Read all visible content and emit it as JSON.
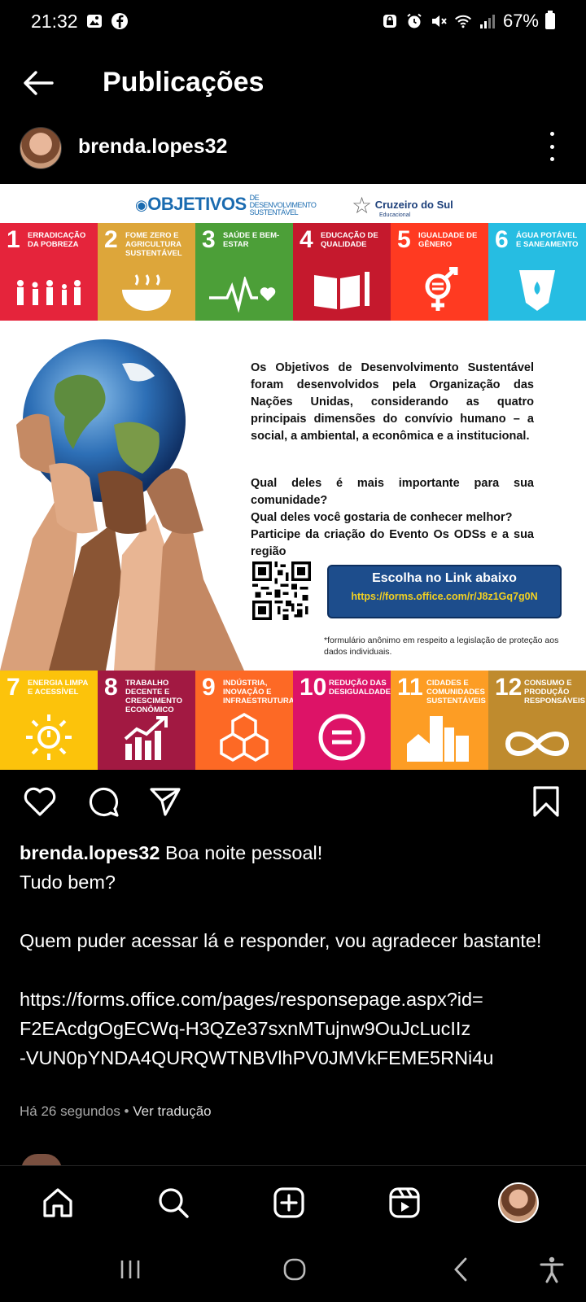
{
  "status_bar": {
    "time": "21:32",
    "battery": "67%"
  },
  "header": {
    "title": "Publicações"
  },
  "post": {
    "author": "brenda.lopes32",
    "image": {
      "logo_text": "OBJETIVOS",
      "logo_small": "DE DESENVOLVIMENTO SUSTENTÁVEL",
      "partner": "Cruzeiro do Sul",
      "partner_sub": "Educacional",
      "top_tiles": [
        {
          "num": "1",
          "label": "ERRADICAÇÃO DA POBREZA",
          "color": "#e5243b"
        },
        {
          "num": "2",
          "label": "FOME ZERO E AGRICULTURA SUSTENTÁVEL",
          "color": "#dda63a"
        },
        {
          "num": "3",
          "label": "SAÚDE E BEM-ESTAR",
          "color": "#4c9f38"
        },
        {
          "num": "4",
          "label": "EDUCAÇÃO DE QUALIDADE",
          "color": "#c5192d"
        },
        {
          "num": "5",
          "label": "IGUALDADE DE GÊNERO",
          "color": "#ff3a21"
        },
        {
          "num": "6",
          "label": "ÁGUA POTÁVEL E SANEAMENTO",
          "color": "#26bde2"
        }
      ],
      "bottom_tiles": [
        {
          "num": "7",
          "label": "ENERGIA LIMPA E ACESSÍVEL",
          "color": "#fcc30b"
        },
        {
          "num": "8",
          "label": "TRABALHO DECENTE E CRESCIMENTO ECONÔMICO",
          "color": "#a21942"
        },
        {
          "num": "9",
          "label": "INDÚSTRIA, INOVAÇÃO E INFRAESTRUTURA",
          "color": "#fd6925"
        },
        {
          "num": "10",
          "label": "REDUÇÃO DAS DESIGUALDADES",
          "color": "#dd1367"
        },
        {
          "num": "11",
          "label": "CIDADES E COMUNIDADES SUSTENTÁVEIS",
          "color": "#fd9d24"
        },
        {
          "num": "12",
          "label": "CONSUMO E PRODUÇÃO RESPONSÁVEIS",
          "color": "#bf8b2e"
        }
      ],
      "paragraph": "Os Objetivos de Desenvolvimento Sustentável foram desenvolvidos pela Organização das Nações Unidas, considerando as quatro principais dimensões do convívio humano – a social, a ambiental, a econômica e a institucional.",
      "question1": "Qual deles é mais importante para sua comunidade?",
      "question2": "Qual deles você gostaria de conhecer melhor?",
      "question3": "Participe da criação do Evento Os ODSs e a sua região",
      "link_title": "Escolha no Link abaixo",
      "link_url": "https://forms.office.com/r/J8z1Gq7g0N",
      "note": "*formulário anônimo em respeito a legislação de proteção aos dados individuais."
    },
    "caption": {
      "user": "brenda.lopes32",
      "line1": "Boa noite pessoal!",
      "line2": "Tudo bem?",
      "line3": "Quem puder acessar lá e responder, vou agradecer bastante!",
      "link_line1": "https://forms.office.com/pages/responsepage.aspx?id=",
      "link_line2": "F2EAcdgOgECWq-H3QZe37sxnMTujnw9OuJcLucIIz",
      "link_line3": "-VUN0pYNDA4QURQWTNBVlhPV0JMVkFEME5RNi4u"
    },
    "time_ago": "Há 26 segundos",
    "translate": "Ver tradução"
  },
  "colors": {
    "background": "#000000",
    "text": "#ffffff",
    "muted": "#a8a8a8"
  }
}
